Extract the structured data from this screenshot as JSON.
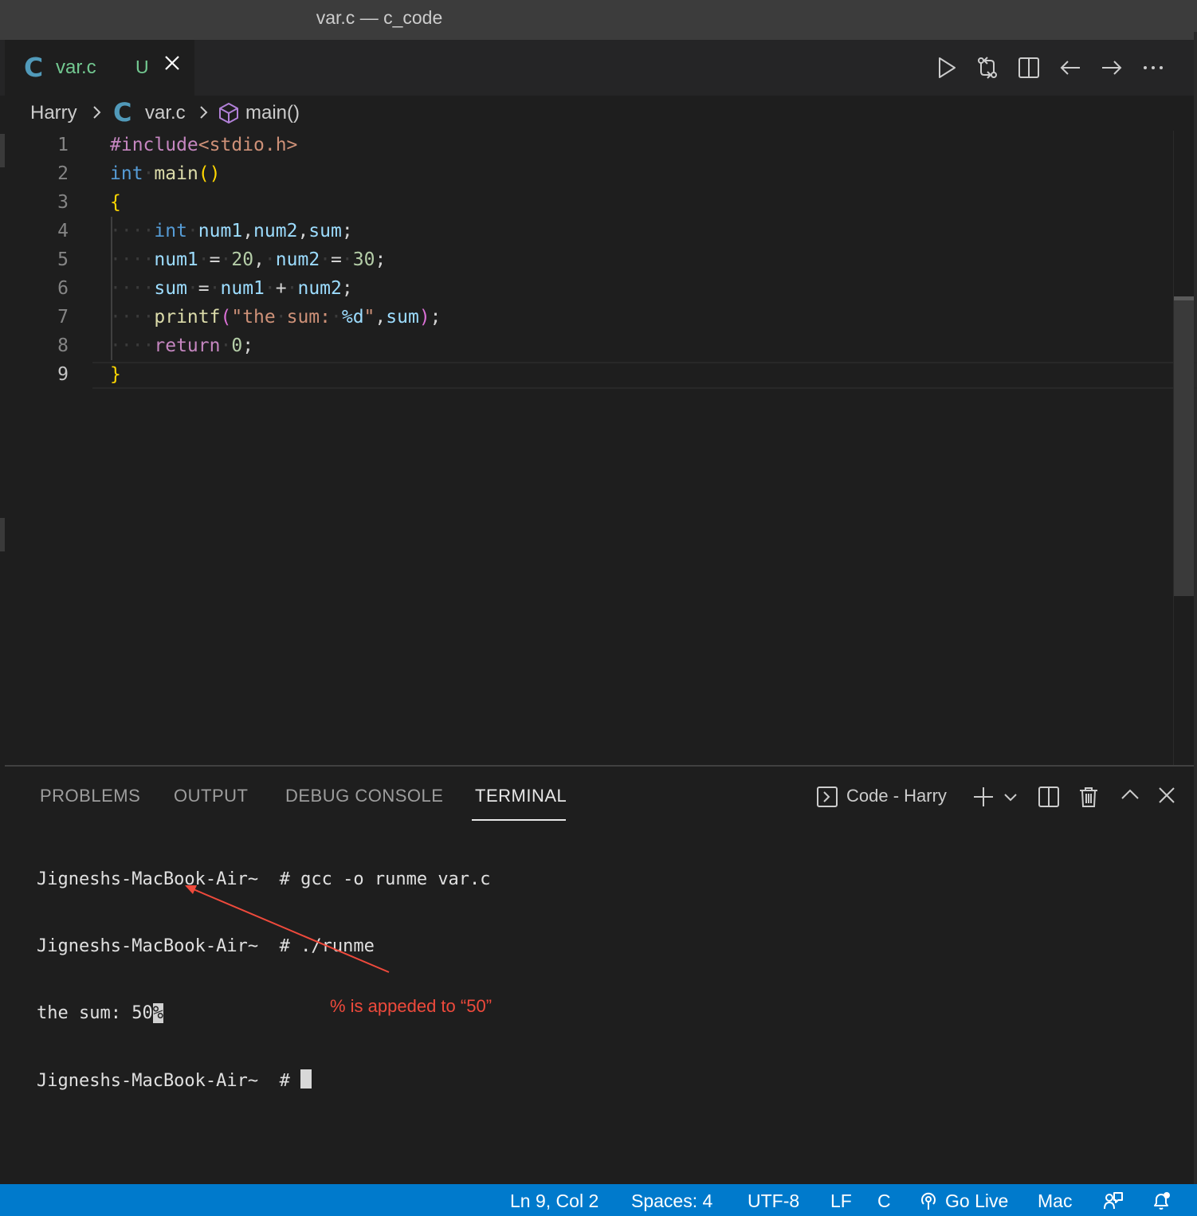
{
  "window": {
    "title": "var.c — c_code"
  },
  "tab": {
    "icon_letter": "C",
    "file_name": "var.c",
    "status": "U"
  },
  "breadcrumb": {
    "folder": "Harry",
    "c_letter": "C",
    "file": "var.c",
    "symbol": "main()"
  },
  "editor": {
    "line_numbers": [
      "1",
      "2",
      "3",
      "4",
      "5",
      "6",
      "7",
      "8",
      "9"
    ],
    "lines": [
      "#include<stdio.h>",
      "int main()",
      "{",
      "    int num1,num2,sum;",
      "    num1 = 20, num2 = 30;",
      "    sum = num1 + num2;",
      "    printf(\"the sum: %d\",sum);",
      "    return 0;",
      "}"
    ],
    "active_line": 9
  },
  "panel": {
    "tabs": [
      "PROBLEMS",
      "OUTPUT",
      "DEBUG CONSOLE",
      "TERMINAL"
    ],
    "active_tab": "TERMINAL",
    "terminal_name": "Code - Harry"
  },
  "terminal": {
    "line1": "Jigneshs-MacBook-Air~  # gcc -o runme var.c",
    "line2": "Jigneshs-MacBook-Air~  # ./runme",
    "line3_text": "the sum: 50",
    "line3_pct": "%",
    "line4": "Jigneshs-MacBook-Air~  # "
  },
  "annotation": {
    "text": "% is appeded to “50”",
    "color": "#ef4a3c"
  },
  "statusbar": {
    "position": "Ln 9, Col 2",
    "spaces": "Spaces: 4",
    "encoding": "UTF-8",
    "eol": "LF",
    "language": "C",
    "go_live": "Go Live",
    "os": "Mac",
    "background": "#007acc"
  }
}
